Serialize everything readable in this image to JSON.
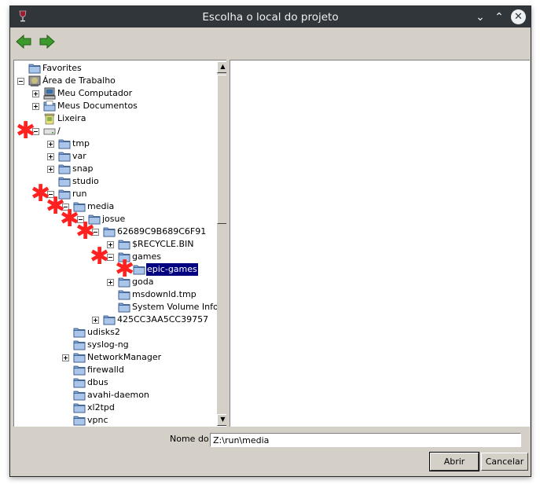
{
  "window": {
    "title": "Escolha o local do projeto"
  },
  "titlebar": {
    "minimize_glyph": "⌄",
    "maximize_glyph": "⌃",
    "close_glyph": "✕"
  },
  "tree": {
    "scroll_up_glyph": "▲",
    "scroll_down_glyph": "▼",
    "rows": [
      {
        "label": "Favorites",
        "icon": "folder-icon",
        "expander": "none",
        "star": false,
        "selected": false
      },
      {
        "label": "Área de Trabalho",
        "icon": "desktop-icon",
        "expander": "minus",
        "star": false,
        "selected": false
      },
      {
        "label": "Meu Computador",
        "icon": "computer-icon",
        "expander": "plus",
        "star": false,
        "selected": false
      },
      {
        "label": "Meus Documentos",
        "icon": "documents-icon",
        "expander": "plus",
        "star": false,
        "selected": false
      },
      {
        "label": "Lixeira",
        "icon": "trash-icon",
        "expander": "none",
        "star": false,
        "selected": false
      },
      {
        "label": "/",
        "icon": "drive-icon",
        "expander": "minus",
        "star": true,
        "selected": false
      },
      {
        "label": "tmp",
        "icon": "folder-icon",
        "expander": "plus",
        "star": false,
        "selected": false
      },
      {
        "label": "var",
        "icon": "folder-icon",
        "expander": "plus",
        "star": false,
        "selected": false
      },
      {
        "label": "snap",
        "icon": "folder-icon",
        "expander": "plus",
        "star": false,
        "selected": false
      },
      {
        "label": "studio",
        "icon": "folder-icon",
        "expander": "none",
        "star": false,
        "selected": false
      },
      {
        "label": "run",
        "icon": "folder-icon",
        "expander": "minus",
        "star": true,
        "selected": false
      },
      {
        "label": "media",
        "icon": "folder-icon",
        "expander": "minus",
        "star": true,
        "selected": false
      },
      {
        "label": "josue",
        "icon": "folder-icon",
        "expander": "minus",
        "star": true,
        "selected": false
      },
      {
        "label": "62689C9B689C6F91",
        "icon": "folder-icon",
        "expander": "minus",
        "star": true,
        "selected": false
      },
      {
        "label": "$RECYCLE.BIN",
        "icon": "folder-icon",
        "expander": "plus",
        "star": false,
        "selected": false
      },
      {
        "label": "games",
        "icon": "folder-icon",
        "expander": "minus",
        "star": true,
        "selected": false
      },
      {
        "label": "epic-games",
        "icon": "folder-icon",
        "expander": "none",
        "star": true,
        "selected": true
      },
      {
        "label": "goda",
        "icon": "folder-icon",
        "expander": "plus",
        "star": false,
        "selected": false
      },
      {
        "label": "msdownld.tmp",
        "icon": "folder-icon",
        "expander": "none",
        "star": false,
        "selected": false
      },
      {
        "label": "System Volume Inform",
        "icon": "folder-icon",
        "expander": "none",
        "star": false,
        "selected": false
      },
      {
        "label": "425CC3AA5CC39757",
        "icon": "folder-icon",
        "expander": "plus",
        "star": false,
        "selected": false
      },
      {
        "label": "udisks2",
        "icon": "folder-icon",
        "expander": "none",
        "star": false,
        "selected": false
      },
      {
        "label": "syslog-ng",
        "icon": "folder-icon",
        "expander": "none",
        "star": false,
        "selected": false
      },
      {
        "label": "NetworkManager",
        "icon": "folder-icon",
        "expander": "plus",
        "star": false,
        "selected": false
      },
      {
        "label": "firewalld",
        "icon": "folder-icon",
        "expander": "none",
        "star": false,
        "selected": false
      },
      {
        "label": "dbus",
        "icon": "folder-icon",
        "expander": "none",
        "star": false,
        "selected": false
      },
      {
        "label": "avahi-daemon",
        "icon": "folder-icon",
        "expander": "none",
        "star": false,
        "selected": false
      },
      {
        "label": "xl2tpd",
        "icon": "folder-icon",
        "expander": "none",
        "star": false,
        "selected": false
      },
      {
        "label": "vpnc",
        "icon": "folder-icon",
        "expander": "none",
        "star": false,
        "selected": false
      },
      {
        "label": "",
        "icon": "folder-icon",
        "expander": "none",
        "star": false,
        "selected": false
      }
    ]
  },
  "form": {
    "name_label": "Nome do",
    "name_value": "Z:\\run\\media"
  },
  "buttons": {
    "open": "Abrir",
    "cancel": "Cancelar"
  },
  "colors": {
    "titlebar": "#31363b",
    "dialog": "#d4d0c8",
    "selection": "#000080",
    "star": "#ff2020",
    "folder": "#7fa8d8",
    "nav_arrow": "#3c9a2c"
  }
}
